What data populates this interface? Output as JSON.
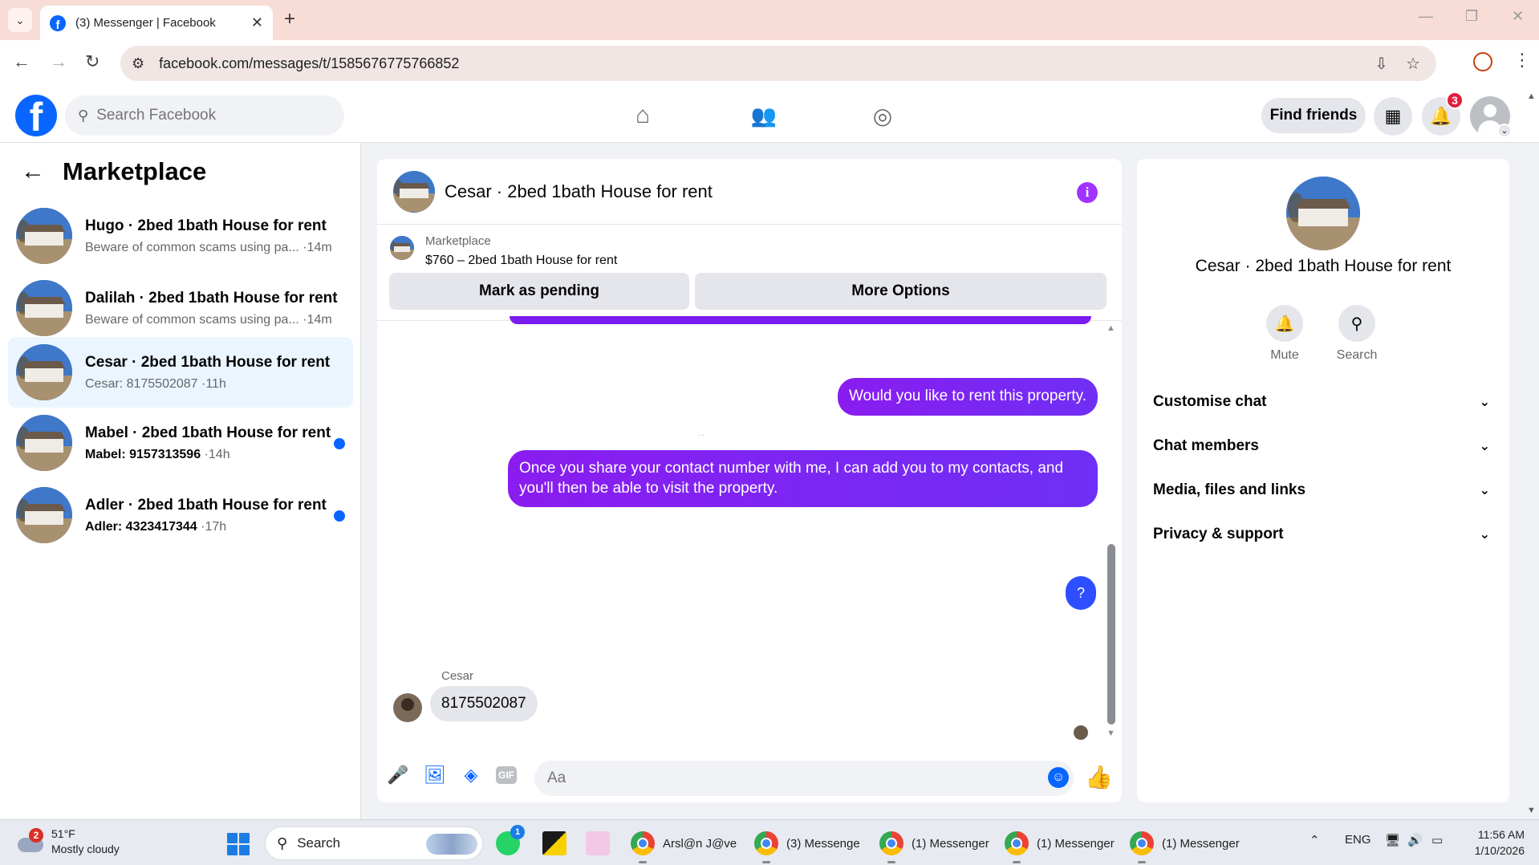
{
  "browser": {
    "tab_title": "(3) Messenger | Facebook",
    "url": "facebook.com/messages/t/1585676775766852"
  },
  "fb_nav": {
    "search_placeholder": "Search Facebook",
    "find_friends_label": "Find friends",
    "notification_count": "3"
  },
  "sidebar": {
    "title": "Marketplace",
    "conversations": [
      {
        "name": "Hugo · 2bed 1bath House for rent",
        "preview": "Beware of common scams using pa...",
        "time": "·14m",
        "unread": false,
        "active": false
      },
      {
        "name": "Dalilah · 2bed 1bath House for rent",
        "preview": "Beware of common scams using pa...",
        "time": "·14m",
        "unread": false,
        "active": false
      },
      {
        "name": "Cesar · 2bed 1bath House for rent",
        "preview": "Cesar: 8175502087",
        "time": "·11h",
        "unread": false,
        "active": true
      },
      {
        "name": "Mabel · 2bed 1bath House for rent",
        "preview": "Mabel: 9157313596",
        "time": "·14h",
        "unread": true,
        "active": false
      },
      {
        "name": "Adler · 2bed 1bath House for rent",
        "preview": "Adler: 4323417344",
        "time": "·17h",
        "unread": true,
        "active": false
      }
    ]
  },
  "chat": {
    "title": "Cesar · 2bed 1bath House for rent",
    "marketplace_label": "Marketplace",
    "listing": "$760 – 2bed 1bath House for rent",
    "mark_pending_label": "Mark as pending",
    "more_options_label": "More Options",
    "messages": {
      "out_1": "Would you like to rent this property.",
      "separator": "..",
      "out_2_line1": "Once you share your contact number with me, I can add you to my contacts, and",
      "out_2_line2": "you'll then be able to visit the property.",
      "out_3": "?",
      "in_sender": "Cesar",
      "in_1": "8175502087"
    },
    "composer_placeholder": "Aa",
    "accent_color": "#7a1bf0"
  },
  "right_panel": {
    "title": "Cesar · 2bed 1bath House for rent",
    "mute_label": "Mute",
    "search_label": "Search",
    "sections": [
      "Customise chat",
      "Chat members",
      "Media, files and links",
      "Privacy & support"
    ]
  },
  "taskbar": {
    "weather_badge": "2",
    "temperature": "51°F",
    "weather_desc": "Mostly cloudy",
    "search_label": "Search",
    "whatsapp_badge": "1",
    "apps": [
      "Arsl@n J@ve",
      "(3) Messenge",
      "(1) Messenger",
      "(1) Messenger",
      "(1) Messenger"
    ],
    "language": "ENG",
    "time": "11:56 AM",
    "date": "1/10/2026"
  }
}
